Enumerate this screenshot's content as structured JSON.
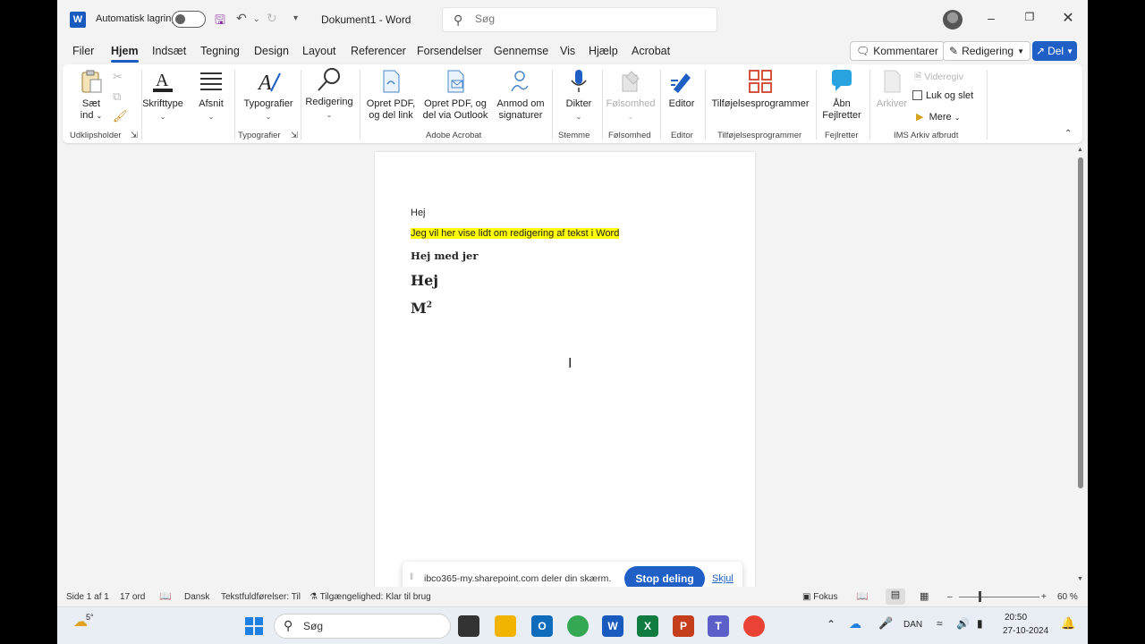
{
  "titlebar": {
    "autosave_label": "Automatisk lagring",
    "doc_title": "Dokument1 - Word",
    "search_placeholder": "Søg"
  },
  "tabs": [
    "Filer",
    "Hjem",
    "Indsæt",
    "Tegning",
    "Design",
    "Layout",
    "Referencer",
    "Forsendelser",
    "Gennemse",
    "Vis",
    "Hjælp",
    "Acrobat"
  ],
  "active_tab": "Hjem",
  "header_buttons": {
    "comments": "Kommentarer",
    "editing": "Redigering",
    "share": "Del"
  },
  "ribbon": {
    "paste_line1": "Sæt",
    "paste_line2": "ind",
    "font": "Skrifttype",
    "paragraph": "Afsnit",
    "styles": "Typografier",
    "editing": "Redigering",
    "pdf_share_link_1": "Opret PDF,",
    "pdf_share_link_2": "og del link",
    "pdf_outlook_1": "Opret PDF, og",
    "pdf_outlook_2": "del via Outlook",
    "signatures_1": "Anmod om",
    "signatures_2": "signaturer",
    "dictate": "Dikter",
    "sensitivity": "Følsomhed",
    "editor": "Editor",
    "addins": "Tilføjelsesprogrammer",
    "fixer_1": "Åbn",
    "fixer_2": "Fejlretter",
    "archive": "Arkiver",
    "forward": "Videregiv",
    "read_delete": "Luk og slet",
    "more": "Mere"
  },
  "groups": {
    "clipboard": "Udklipsholder",
    "styles": "Typografier",
    "adobe": "Adobe Acrobat",
    "voice": "Stemme",
    "sensitivity": "Følsomhed",
    "editor": "Editor",
    "addins": "Tilføjelsesprogrammer",
    "fixer": "Fejlretter",
    "ims": "IMS Arkiv afbrudt"
  },
  "document": {
    "line1": "Hej",
    "line2": "Jeg vil her vise lidt om redigering af tekst i Word",
    "line3": "Hej med jer",
    "line4": "Hej",
    "line5_base": "M",
    "line5_sup": "2"
  },
  "share_banner": {
    "text": "ibco365-my.sharepoint.com deler din skærm.",
    "stop": "Stop deling",
    "hide": "Skjul"
  },
  "statusbar": {
    "page": "Side 1 af 1",
    "words": "17 ord",
    "language": "Dansk",
    "predictions": "Tekstfuldførelser: Til",
    "accessibility": "Tilgængelighed: Klar til brug",
    "focus": "Fokus",
    "zoom": "60 %"
  },
  "taskbar": {
    "weather": "5°",
    "search": "Søg",
    "lang": "DAN",
    "time": "20:50",
    "date": "27-10-2024"
  },
  "colors": {
    "accent": "#185abd",
    "highlight": "#ffff00"
  }
}
